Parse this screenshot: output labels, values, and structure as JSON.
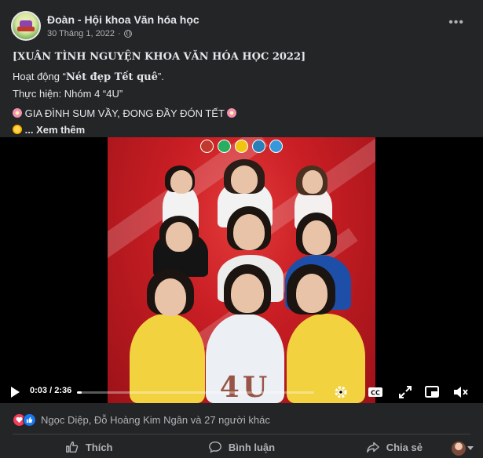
{
  "post": {
    "page_name": "Đoàn - Hội khoa Văn hóa học",
    "date": "30 Tháng 1, 2022",
    "separator": "·",
    "more_label": "•••",
    "title": "[XUÂN TÌNH NGUYỆN KHOA VĂN HÓA HỌC 2022]",
    "activity_prefix": "Hoạt động “",
    "activity_name": "Nét đẹp Tết quê",
    "activity_suffix": "”.",
    "performer_line": "Thực hiện: Nhóm 4 “4U”",
    "slogan": "GIA ĐÌNH SUM VẦY, ĐONG ĐẦY ĐÓN TẾT",
    "see_more": "... Xem thêm"
  },
  "video": {
    "current_time": "0:03",
    "separator": " / ",
    "duration": "2:36",
    "progress_fraction": 0.019,
    "footer_text": "4U"
  },
  "reactions": {
    "text": "Ngọc Diệp, Đỗ Hoàng Kim Ngân và 27 người khác"
  },
  "actions": {
    "like": "Thích",
    "comment": "Bình luận",
    "share": "Chia sẻ"
  },
  "colors": {
    "background": "#242526",
    "text_primary": "#e4e6eb",
    "text_secondary": "#b0b3b8",
    "video_bg": "#c81e24",
    "like_blue": "#1877f2",
    "heart_red": "#f33e58"
  },
  "icons": [
    "globe-icon",
    "more-icon",
    "flower-icon",
    "sun-icon",
    "play-icon",
    "settings-icon",
    "captions-icon",
    "fullscreen-icon",
    "pip-icon",
    "volume-icon",
    "like-icon",
    "comment-icon",
    "share-icon",
    "heart-icon"
  ]
}
